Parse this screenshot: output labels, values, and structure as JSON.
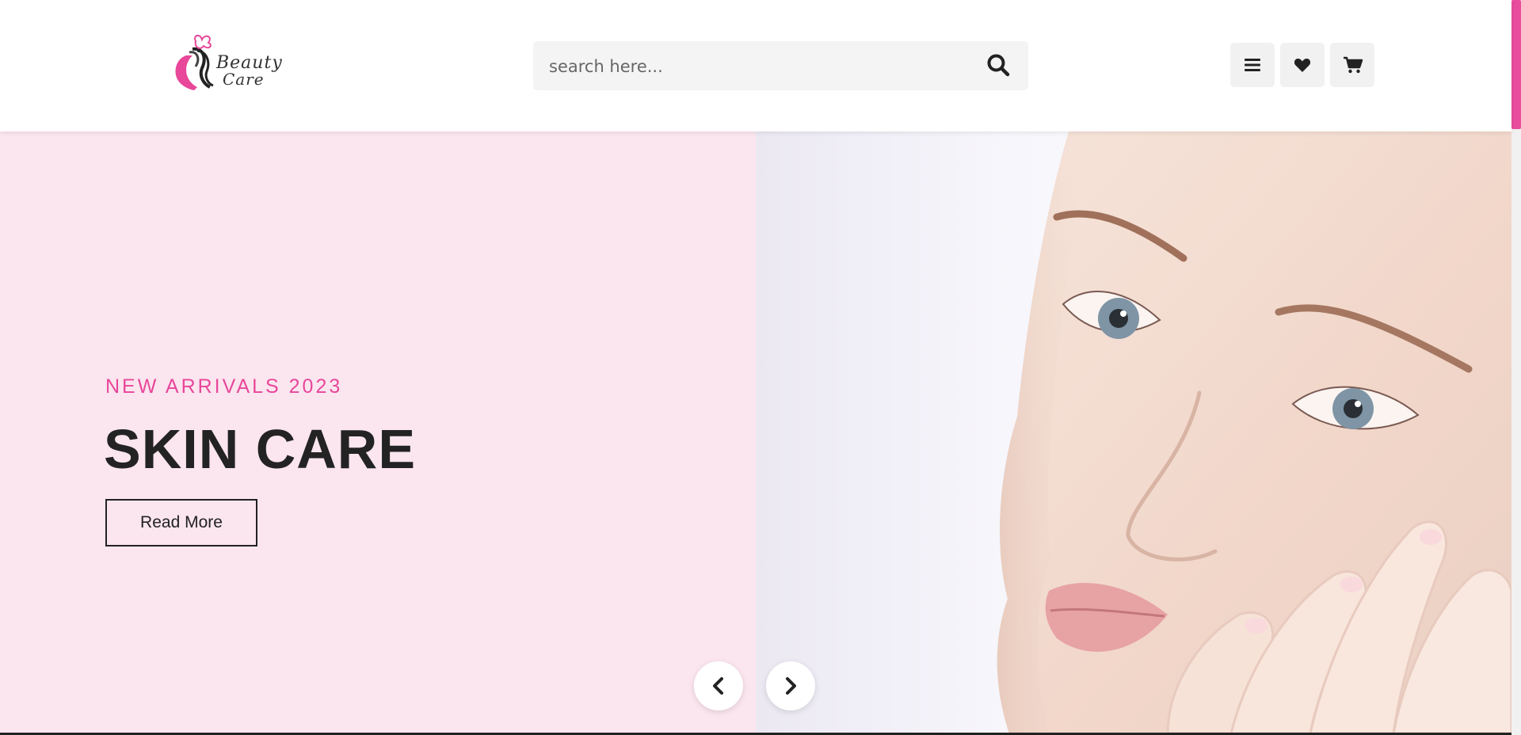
{
  "brand": {
    "logo_line1": "Beauty",
    "logo_line2": "Care",
    "accent_color": "#e8479a"
  },
  "header": {
    "search": {
      "placeholder": "search here...",
      "icon": "search-icon"
    },
    "buttons": [
      {
        "icon": "menu-icon"
      },
      {
        "icon": "heart-icon"
      },
      {
        "icon": "cart-icon"
      }
    ]
  },
  "hero": {
    "subtitle": "NEW ARRIVALS 2023",
    "title": "SKIN CARE",
    "cta_label": "Read More",
    "background_color": "#fbe5ef",
    "prev_icon": "chevron-left-icon",
    "next_icon": "chevron-right-icon"
  }
}
